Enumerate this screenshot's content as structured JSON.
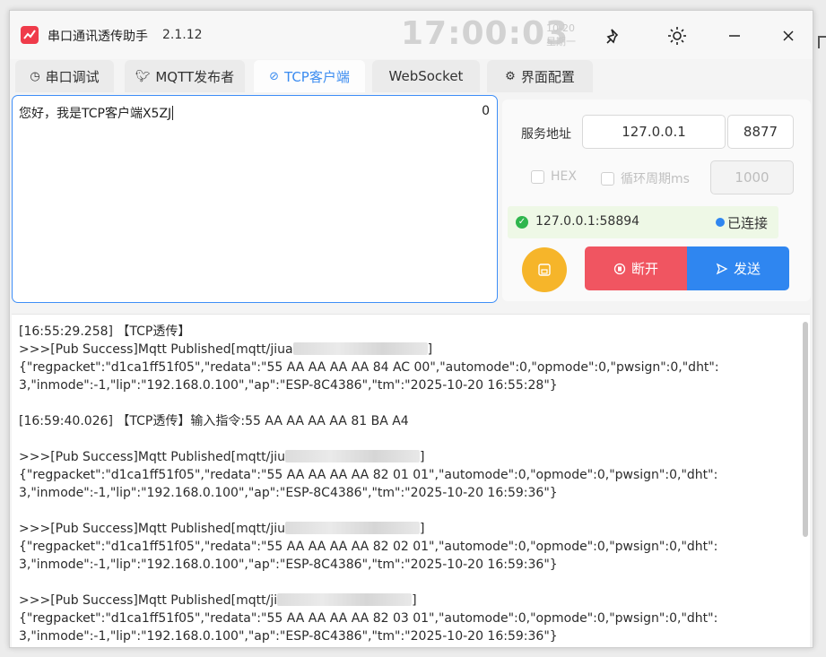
{
  "app": {
    "title": "串口通讯透传助手",
    "version": "2.1.12",
    "clock": "17:00:03",
    "date": "10-20",
    "weekday": "星期一"
  },
  "tabs": [
    {
      "label": "串口调试",
      "icon": "clock-icon",
      "active": false
    },
    {
      "label": "MQTT发布者",
      "icon": "twitter-bird-icon",
      "active": false
    },
    {
      "label": "TCP客户端",
      "icon": "link-icon",
      "active": true
    },
    {
      "label": "WebSocket",
      "icon": "",
      "active": false
    },
    {
      "label": "界面配置",
      "icon": "gear-icon",
      "active": false
    }
  ],
  "editor": {
    "text": "您好，我是TCP客户端X5ZJ",
    "count": "0"
  },
  "settings": {
    "server_label": "服务地址",
    "host": "127.0.0.1",
    "port": "8877",
    "hex_label": "HEX",
    "loop_label": "循环周期ms",
    "loop_value": "1000"
  },
  "connection": {
    "address": "127.0.0.1:58894",
    "state": "已连接"
  },
  "buttons": {
    "disconnect": "断开",
    "send": "发送"
  },
  "colors": {
    "accent": "#2f86f0",
    "danger": "#f05561",
    "warning": "#f6b52a",
    "success": "#2fb64d"
  },
  "log": {
    "lines": [
      {
        "pre": "[16:55:29.258] 【TCP透传】",
        "post": "",
        "blur": false
      },
      {
        "pre": ">>>[Pub Success]Mqtt Published[mqtt/jiua",
        "post": "]",
        "blur": true
      },
      {
        "pre": "{\"regpacket\":\"d1ca1ff51f05\",\"redata\":\"55 AA AA AA AA 84 AC 00\",\"automode\":0,\"opmode\":0,\"pwsign\":0,\"dht\":",
        "post": "",
        "blur": false
      },
      {
        "pre": "3,\"inmode\":-1,\"lip\":\"192.168.0.100\",\"ap\":\"ESP-8C4386\",\"tm\":\"2025-10-20 16:55:28\"}",
        "post": "",
        "blur": false
      },
      {
        "pre": "",
        "post": "",
        "blur": false
      },
      {
        "pre": "[16:59:40.026] 【TCP透传】输入指令:55 AA AA AA AA 81 BA A4",
        "post": "",
        "blur": false
      },
      {
        "pre": "",
        "post": "",
        "blur": false
      },
      {
        "pre": ">>>[Pub Success]Mqtt Published[mqtt/jiu",
        "post": "]",
        "blur": true
      },
      {
        "pre": "{\"regpacket\":\"d1ca1ff51f05\",\"redata\":\"55 AA AA AA AA 82 01 01\",\"automode\":0,\"opmode\":0,\"pwsign\":0,\"dht\":",
        "post": "",
        "blur": false
      },
      {
        "pre": "3,\"inmode\":-1,\"lip\":\"192.168.0.100\",\"ap\":\"ESP-8C4386\",\"tm\":\"2025-10-20 16:59:36\"}",
        "post": "",
        "blur": false
      },
      {
        "pre": "",
        "post": "",
        "blur": false
      },
      {
        "pre": ">>>[Pub Success]Mqtt Published[mqtt/jiu",
        "post": "]",
        "blur": true
      },
      {
        "pre": "{\"regpacket\":\"d1ca1ff51f05\",\"redata\":\"55 AA AA AA AA 82 02 01\",\"automode\":0,\"opmode\":0,\"pwsign\":0,\"dht\":",
        "post": "",
        "blur": false
      },
      {
        "pre": "3,\"inmode\":-1,\"lip\":\"192.168.0.100\",\"ap\":\"ESP-8C4386\",\"tm\":\"2025-10-20 16:59:36\"}",
        "post": "",
        "blur": false
      },
      {
        "pre": "",
        "post": "",
        "blur": false
      },
      {
        "pre": ">>>[Pub Success]Mqtt Published[mqtt/ji",
        "post": "]",
        "blur": true
      },
      {
        "pre": "{\"regpacket\":\"d1ca1ff51f05\",\"redata\":\"55 AA AA AA AA 82 03 01\",\"automode\":0,\"opmode\":0,\"pwsign\":0,\"dht\":",
        "post": "",
        "blur": false
      },
      {
        "pre": "3,\"inmode\":-1,\"lip\":\"192.168.0.100\",\"ap\":\"ESP-8C4386\",\"tm\":\"2025-10-20 16:59:36\"}",
        "post": "",
        "blur": false
      }
    ]
  }
}
